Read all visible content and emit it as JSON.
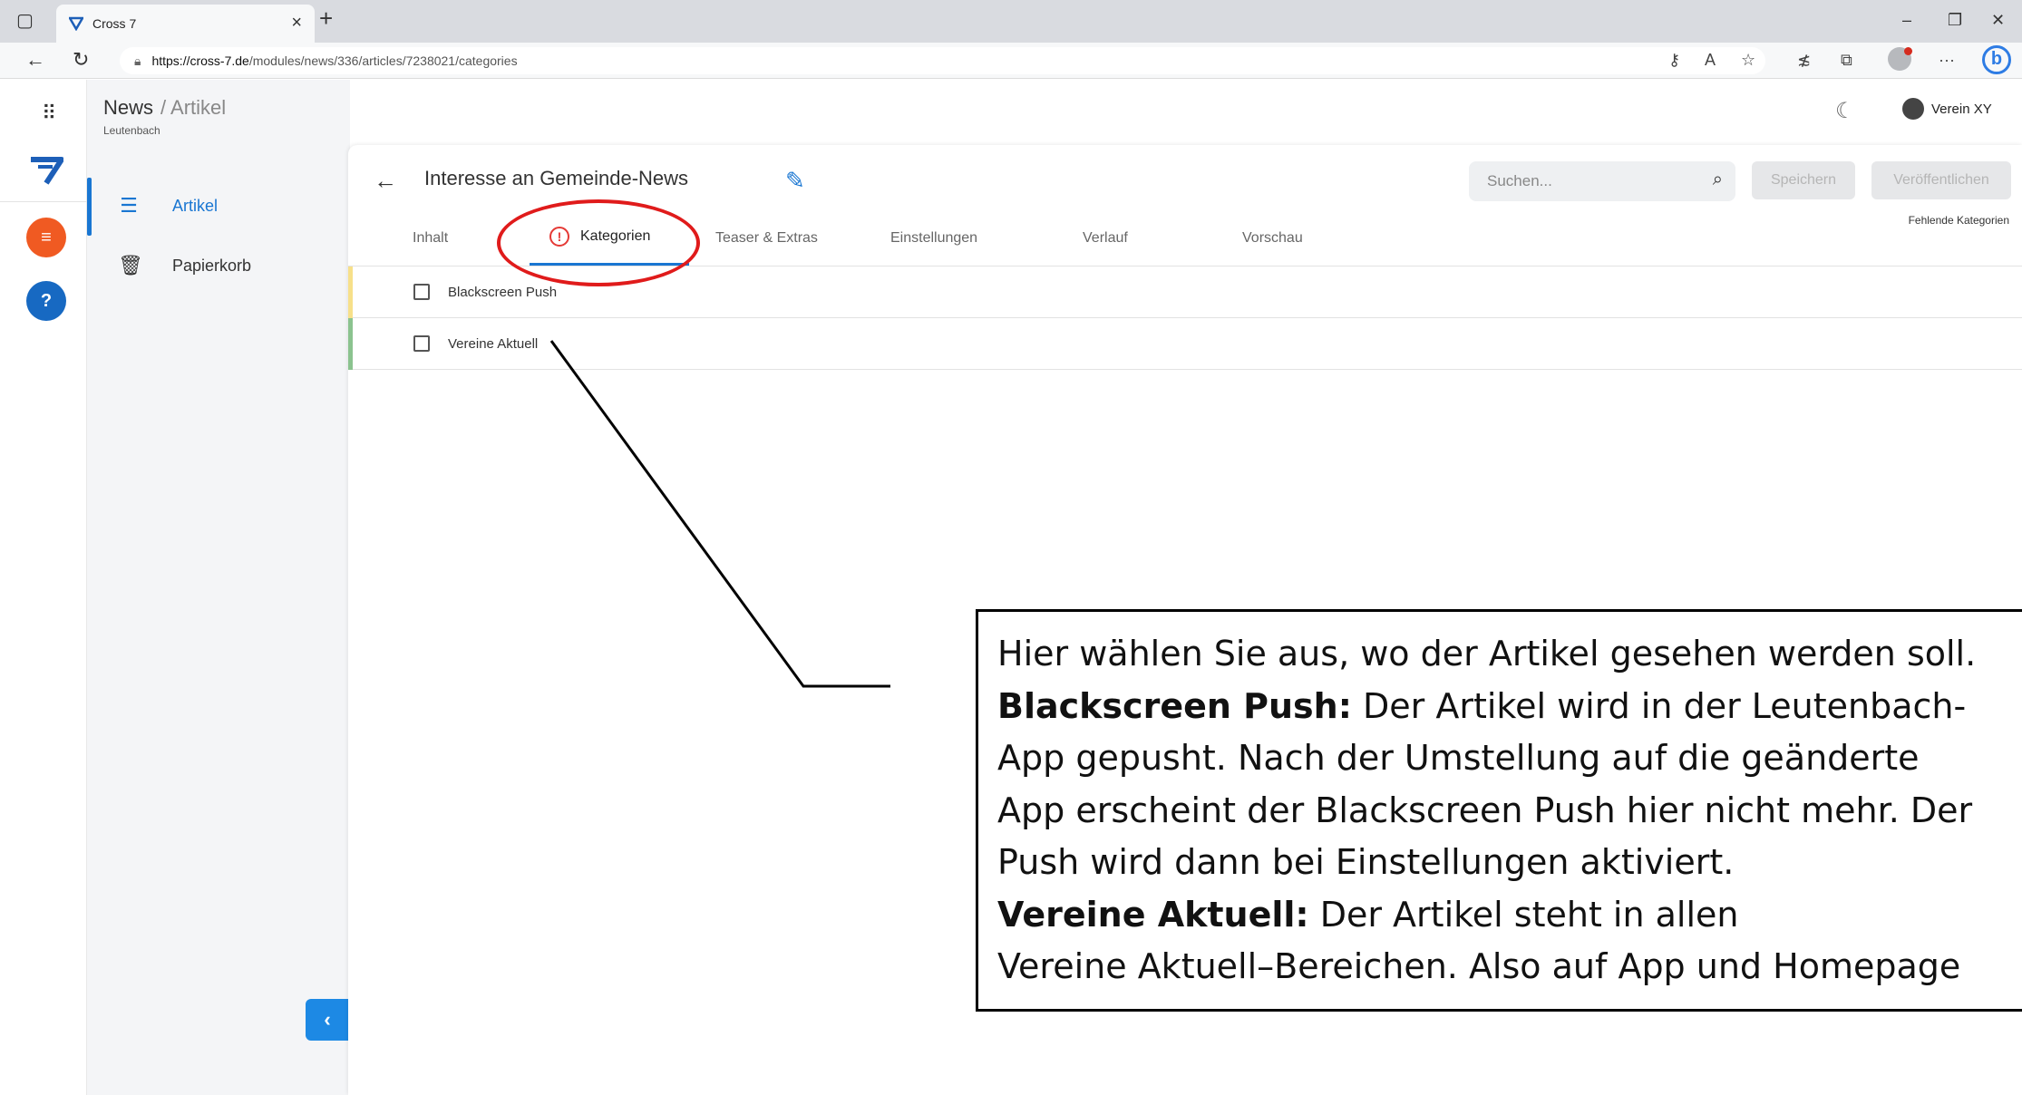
{
  "browser": {
    "tab_title": "Cross 7",
    "url_host": "https://cross-7.de",
    "url_path": "/modules/news/336/articles/7238021/categories"
  },
  "header": {
    "module": "News",
    "section": "/ Artikel",
    "org": "Leutenbach",
    "user": "Verein XY"
  },
  "sidebar": {
    "items": [
      {
        "label": "Artikel",
        "icon": "list-icon",
        "active": true
      },
      {
        "label": "Papierkorb",
        "icon": "trash-icon",
        "active": false
      }
    ]
  },
  "article": {
    "title": "Interesse an Gemeinde-News"
  },
  "toolbar": {
    "search_placeholder": "Suchen...",
    "save_label": "Speichern",
    "publish_label": "Veröffentlichen",
    "missing_note": "Fehlende Kategorien"
  },
  "tabs": [
    {
      "label": "Inhalt"
    },
    {
      "label": "Kategorien",
      "active": true,
      "warning": true
    },
    {
      "label": "Teaser & Extras"
    },
    {
      "label": "Einstellungen"
    },
    {
      "label": "Verlauf"
    },
    {
      "label": "Vorschau"
    }
  ],
  "categories": [
    {
      "label": "Blackscreen Push",
      "checked": false,
      "stripe_color": "#f7e08a"
    },
    {
      "label": "Vereine Aktuell",
      "checked": false,
      "stripe_color": "#8bc38f"
    }
  ],
  "callout": {
    "line1": "Hier wählen Sie aus, wo der Artikel gesehen werden soll.",
    "bs_title": "Blackscreen Push:",
    "bs_text_a": " Der Artikel wird in der Leutenbach-",
    "bs_text_b": "App gepusht. Nach der Umstellung auf die geänderte",
    "bs_text_c": "App erscheint der Blackscreen Push hier nicht mehr. Der",
    "bs_text_d": "Push wird dann bei Einstellungen aktiviert.",
    "va_title": "Vereine Aktuell:",
    "va_text_a": " Der Artikel steht in allen",
    "va_text_b": "Vereine Aktuell–Bereichen. Also auf App und Homepage"
  },
  "colors": {
    "accent": "#1976d2",
    "warning": "#e53935",
    "annotation_red": "#e01b1b"
  }
}
